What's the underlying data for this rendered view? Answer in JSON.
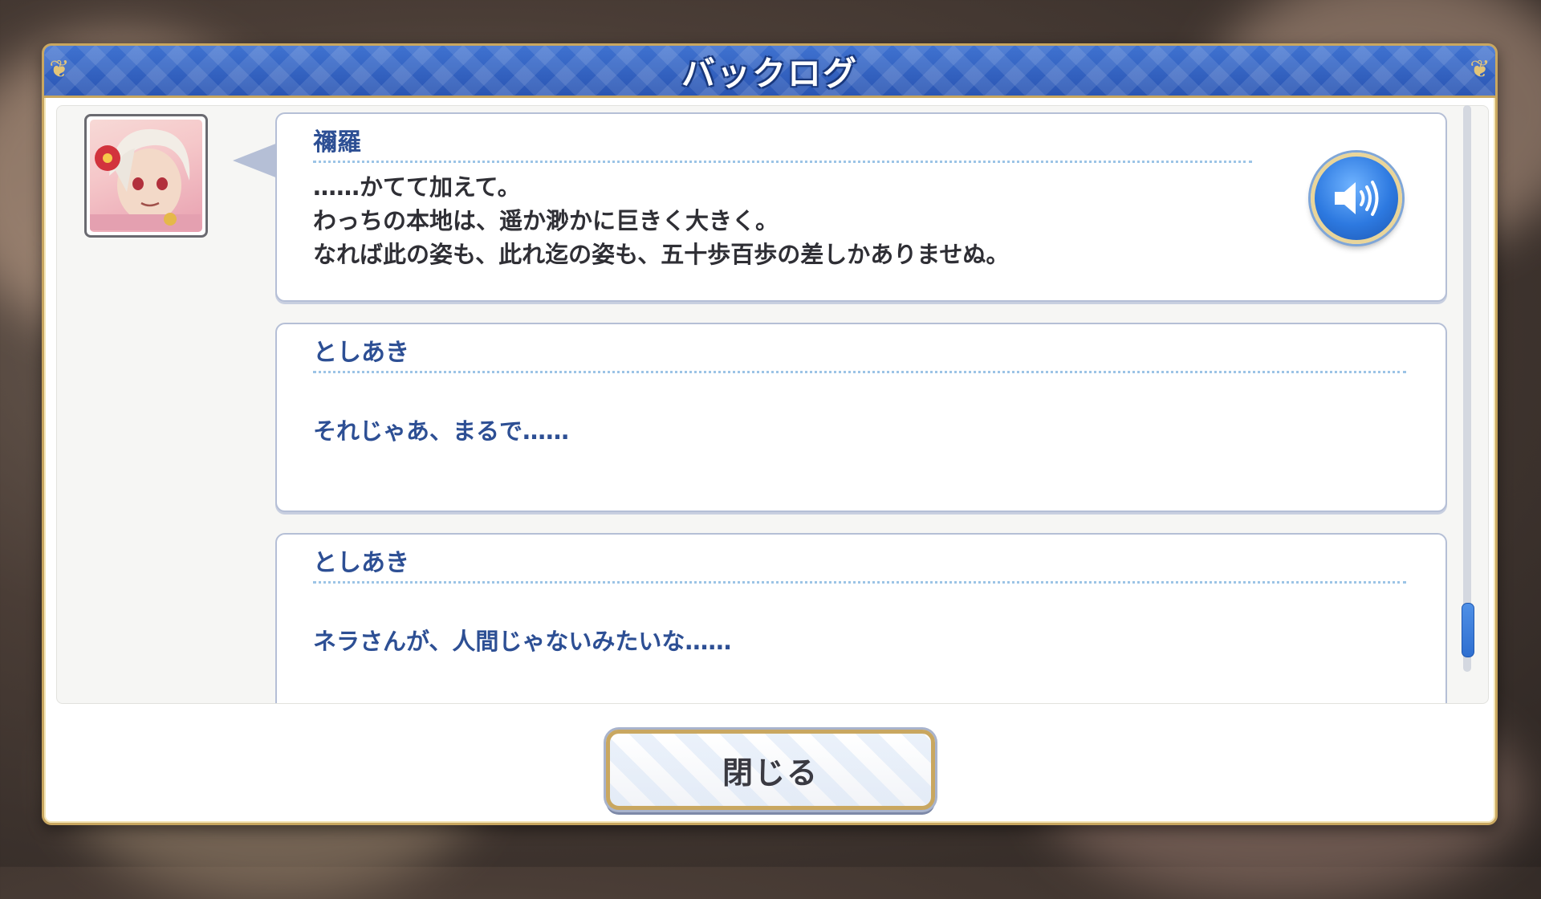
{
  "dialog": {
    "title": "バックログ",
    "close_label": "閉じる"
  },
  "entries": [
    {
      "speaker": "禰羅",
      "lines": [
        "……かてて加えて。",
        "わっちの本地は、遥か渺かに巨きく大きく。",
        "なれば此の姿も、此れ迄の姿も、五十歩百歩の差しかありませぬ。"
      ],
      "has_portrait": true,
      "has_voice": true
    },
    {
      "speaker": "としあき",
      "lines": [
        "それじゃあ、まるで……"
      ],
      "has_portrait": false,
      "has_voice": false
    },
    {
      "speaker": "としあき",
      "lines": [
        "ネラさんが、人間じゃないみたいな……"
      ],
      "has_portrait": false,
      "has_voice": false
    }
  ],
  "icons": {
    "voice": "speaker-volume-icon",
    "portrait": "character-portrait"
  },
  "colors": {
    "title_bar": "#2f62c4",
    "frame_gold": "#c9a760",
    "speaker_name": "#2d4f94",
    "player_text": "#2d4f94",
    "npc_text": "#2f2f35",
    "voice_button": "#2d79e0"
  }
}
